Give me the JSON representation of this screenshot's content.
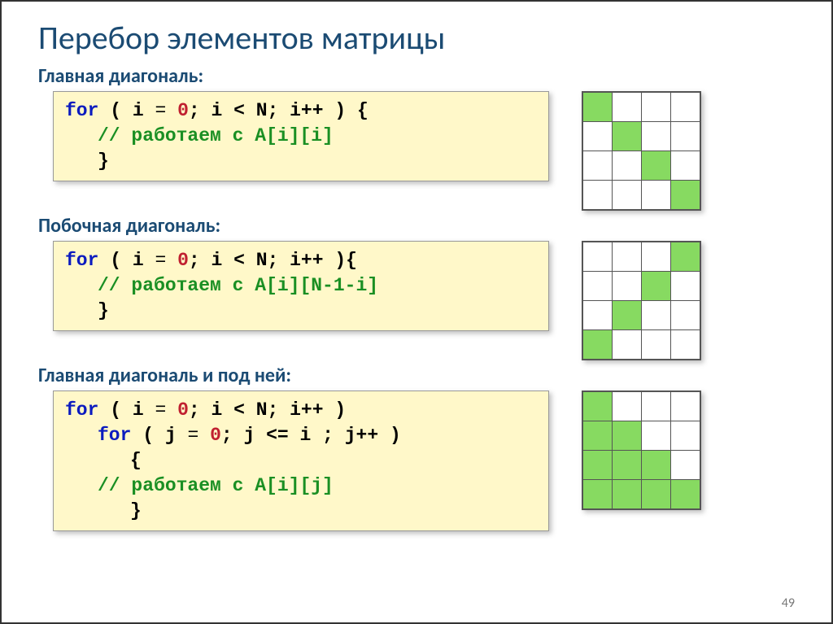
{
  "title": "Перебор элементов матрицы",
  "sections": [
    {
      "label": "Главная диагональ:",
      "code": [
        {
          "cls": "",
          "tokens": [
            {
              "t": "for",
              "c": "kw-for"
            },
            {
              "t": " ( ",
              "c": "paren"
            },
            {
              "t": "i",
              "c": "bold"
            },
            {
              "t": " = ",
              "c": ""
            },
            {
              "t": "0",
              "c": "num"
            },
            {
              "t": "; i",
              "c": "bold"
            },
            {
              "t": " < N; i++ ",
              "c": "bold"
            },
            {
              "t": ") {",
              "c": "paren"
            }
          ]
        },
        {
          "cls": "indent1",
          "tokens": [
            {
              "t": "// работаем с  A[i][i]",
              "c": "comment"
            }
          ]
        },
        {
          "cls": "indent1",
          "tokens": [
            {
              "t": "}",
              "c": "bold"
            }
          ]
        }
      ],
      "matrix": [
        [
          1,
          0,
          0,
          0
        ],
        [
          0,
          1,
          0,
          0
        ],
        [
          0,
          0,
          1,
          0
        ],
        [
          0,
          0,
          0,
          1
        ]
      ]
    },
    {
      "label": "Побочная диагональ:",
      "code": [
        {
          "cls": "",
          "tokens": [
            {
              "t": "for",
              "c": "kw-for"
            },
            {
              "t": " ( ",
              "c": "paren"
            },
            {
              "t": "i",
              "c": "bold"
            },
            {
              "t": " = ",
              "c": ""
            },
            {
              "t": "0",
              "c": "num"
            },
            {
              "t": "; i",
              "c": "bold"
            },
            {
              "t": " < N; i++ ",
              "c": "bold"
            },
            {
              "t": "){",
              "c": "paren"
            }
          ]
        },
        {
          "cls": "indent1",
          "tokens": [
            {
              "t": "// работаем с  A[i][N-1-i]",
              "c": "comment"
            }
          ]
        },
        {
          "cls": "indent1",
          "tokens": [
            {
              "t": "}",
              "c": "bold"
            }
          ]
        }
      ],
      "matrix": [
        [
          0,
          0,
          0,
          1
        ],
        [
          0,
          0,
          1,
          0
        ],
        [
          0,
          1,
          0,
          0
        ],
        [
          1,
          0,
          0,
          0
        ]
      ]
    },
    {
      "label": "Главная диагональ и под ней:",
      "code": [
        {
          "cls": "",
          "tokens": [
            {
              "t": "for",
              "c": "kw-for"
            },
            {
              "t": " ( ",
              "c": "paren"
            },
            {
              "t": "i",
              "c": "bold"
            },
            {
              "t": " = ",
              "c": ""
            },
            {
              "t": "0",
              "c": "num"
            },
            {
              "t": "; i",
              "c": "bold"
            },
            {
              "t": " < N; i++ ",
              "c": "bold"
            },
            {
              "t": ")",
              "c": "paren"
            }
          ]
        },
        {
          "cls": "indent1",
          "tokens": [
            {
              "t": "for",
              "c": "kw-for"
            },
            {
              "t": " ( ",
              "c": "paren"
            },
            {
              "t": "j",
              "c": "bold"
            },
            {
              "t": " = ",
              "c": ""
            },
            {
              "t": "0",
              "c": "num"
            },
            {
              "t": "; j",
              "c": "bold"
            },
            {
              "t": " <= i ; j++ ",
              "c": "bold"
            },
            {
              "t": ")",
              "c": "paren"
            }
          ]
        },
        {
          "cls": "indent2",
          "tokens": [
            {
              "t": "{",
              "c": "bold"
            }
          ]
        },
        {
          "cls": "indent1",
          "tokens": [
            {
              "t": "// работаем с  A[i][j]",
              "c": "comment"
            }
          ]
        },
        {
          "cls": "indent2",
          "tokens": [
            {
              "t": "}",
              "c": "bold"
            }
          ]
        }
      ],
      "matrix": [
        [
          1,
          0,
          0,
          0
        ],
        [
          1,
          1,
          0,
          0
        ],
        [
          1,
          1,
          1,
          0
        ],
        [
          1,
          1,
          1,
          1
        ]
      ]
    }
  ],
  "page_number": "49"
}
